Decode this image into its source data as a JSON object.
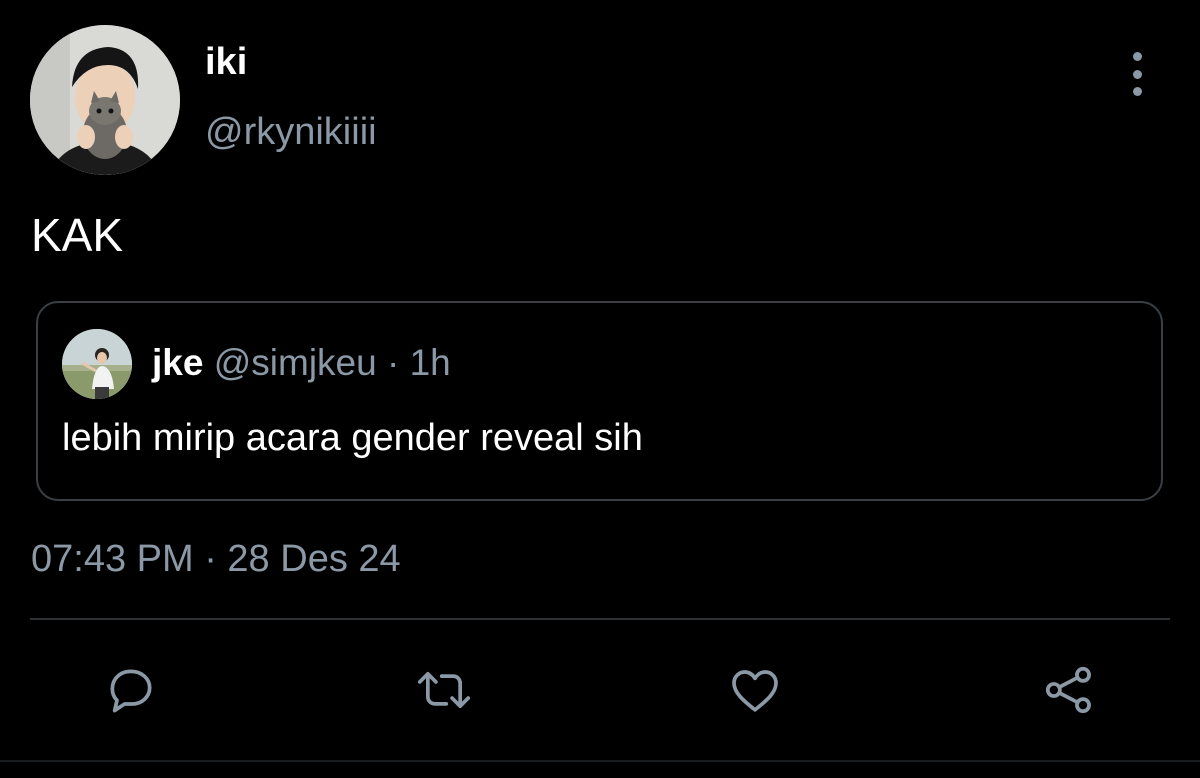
{
  "tweet": {
    "author": {
      "display_name": "iki",
      "handle": "@rkynikiiii",
      "avatar_icon": "profile-photo"
    },
    "text": "KAK",
    "quoted_tweet": {
      "display_name": "jke",
      "handle": "@simjkeu",
      "separator": "·",
      "time": "1h",
      "text": "lebih mirip acara gender reveal sih",
      "avatar_icon": "profile-photo"
    },
    "timestamp": "07:43 PM · 28 Des 24"
  },
  "actions": [
    {
      "icon": "reply-icon"
    },
    {
      "icon": "retweet-icon"
    },
    {
      "icon": "like-icon"
    },
    {
      "icon": "share-icon"
    }
  ],
  "colors": {
    "background": "#000000",
    "primary_text": "#ffffff",
    "secondary_text": "#8b98a5",
    "border": "#3a3f44"
  }
}
